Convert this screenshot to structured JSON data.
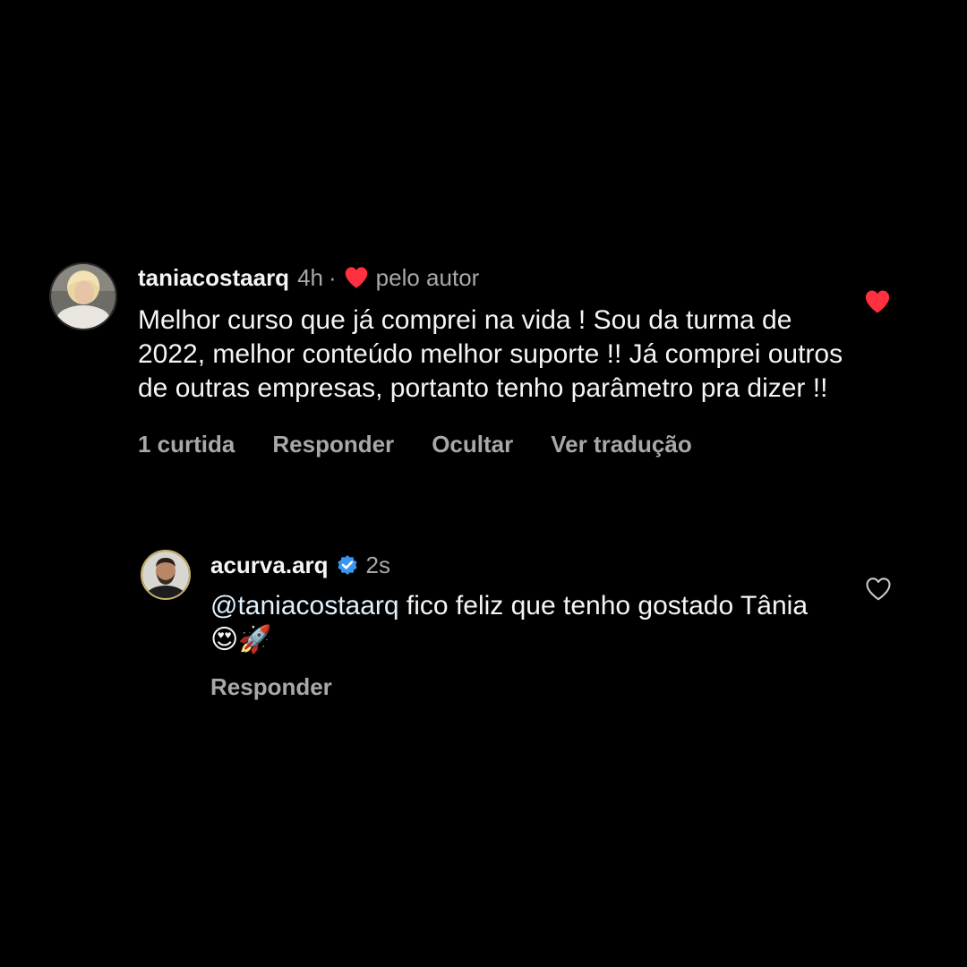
{
  "colors": {
    "background": "#000000",
    "primary_text": "#f5f5f5",
    "secondary_text": "#a8a8a8",
    "like_red": "#ff3040",
    "verified_blue": "#3797f0"
  },
  "comments": [
    {
      "username": "taniacostaarq",
      "time": "4h",
      "separator": "·",
      "liked_by_author_label": "pelo autor",
      "text": "Melhor curso que já comprei na vida ! Sou da turma de 2022, melhor conteúdo melhor suporte !! Já comprei outros de outras empresas, portanto tenho parâmetro pra dizer !!",
      "actions": {
        "likes": "1 curtida",
        "reply": "Responder",
        "hide": "Ocultar",
        "translate": "Ver tradução"
      },
      "like_state": "liked",
      "avatar_icon": "profile-photo-woman"
    },
    {
      "username": "acurva.arq",
      "verified": true,
      "time": "2s",
      "mention": "@taniacostaarq",
      "text": " fico feliz que tenho gostado Tânia ",
      "emojis": "😍🚀",
      "actions": {
        "reply": "Responder"
      },
      "like_state": "not-liked",
      "avatar_icon": "profile-photo-man"
    }
  ]
}
